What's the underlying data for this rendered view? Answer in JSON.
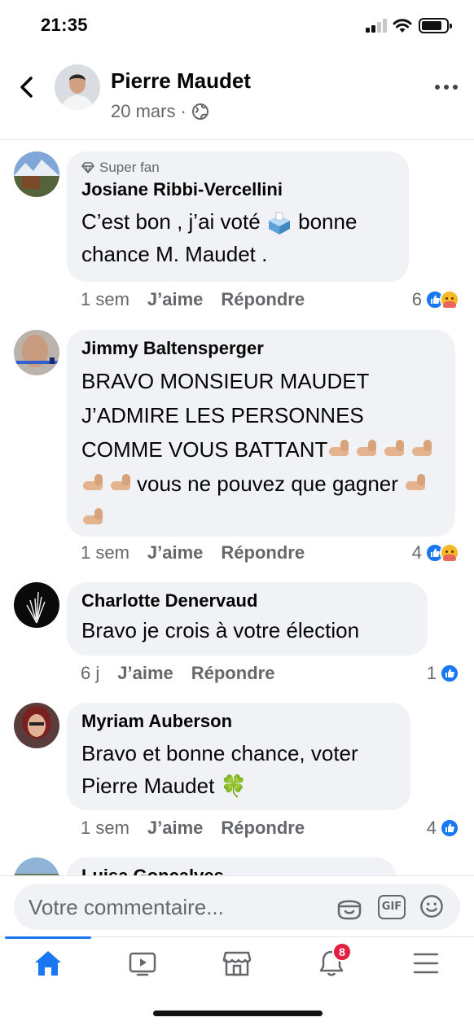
{
  "status_bar": {
    "time": "21:35"
  },
  "header": {
    "author": "Pierre Maudet",
    "date": "20 mars",
    "separator": "·",
    "privacy_icon": "globe-icon",
    "back_icon": "chevron-left-icon",
    "more_icon": "more-horizontal-icon"
  },
  "comments": [
    {
      "badge": "Super fan",
      "author": "Josiane Ribbi-Vercellini",
      "text_parts": [
        "C’est bon ,  j’ai voté ",
        " bonne chance M. Maudet ."
      ],
      "time": "1 sem",
      "like_label": "J’aime",
      "reply_label": "Répondre",
      "reaction_count": "6",
      "reactions": [
        "like",
        "care"
      ]
    },
    {
      "author": "Jimmy Baltensperger",
      "text_parts": [
        "BRAVO MONSIEUR MAUDET J’ADMIRE LES PERSONNES COMME VOUS BATTANT",
        "vous ne pouvez que gagner"
      ],
      "time": "1 sem",
      "like_label": "J’aime",
      "reply_label": "Répondre",
      "reaction_count": "4",
      "reactions": [
        "like",
        "care"
      ]
    },
    {
      "author": "Charlotte Denervaud",
      "text": "Bravo  je crois à  votre  élection",
      "time": "6 j",
      "like_label": "J’aime",
      "reply_label": "Répondre",
      "reaction_count": "1",
      "reactions": [
        "like"
      ]
    },
    {
      "author": "Myriam Auberson",
      "text": "Bravo et bonne chance, voter Pierre Maudet 🍀",
      "time": "1 sem",
      "like_label": "J’aime",
      "reply_label": "Répondre",
      "reaction_count": "4",
      "reactions": [
        "like"
      ]
    },
    {
      "author": "Luisa Goncalves"
    }
  ],
  "composer": {
    "placeholder": "Votre commentaire...",
    "gif_label": "GIF",
    "sticker_icon": "sticker-icon",
    "emoji_icon": "emoji-icon"
  },
  "tabbar": {
    "active": "home",
    "notification_badge": "8",
    "tabs": [
      "home-icon",
      "video-icon",
      "marketplace-icon",
      "bell-icon",
      "menu-icon"
    ]
  },
  "colors": {
    "accent": "#1877f2",
    "bubble": "#f0f2f5",
    "secondary_text": "#65676b",
    "badge_red": "#e41e3f"
  }
}
